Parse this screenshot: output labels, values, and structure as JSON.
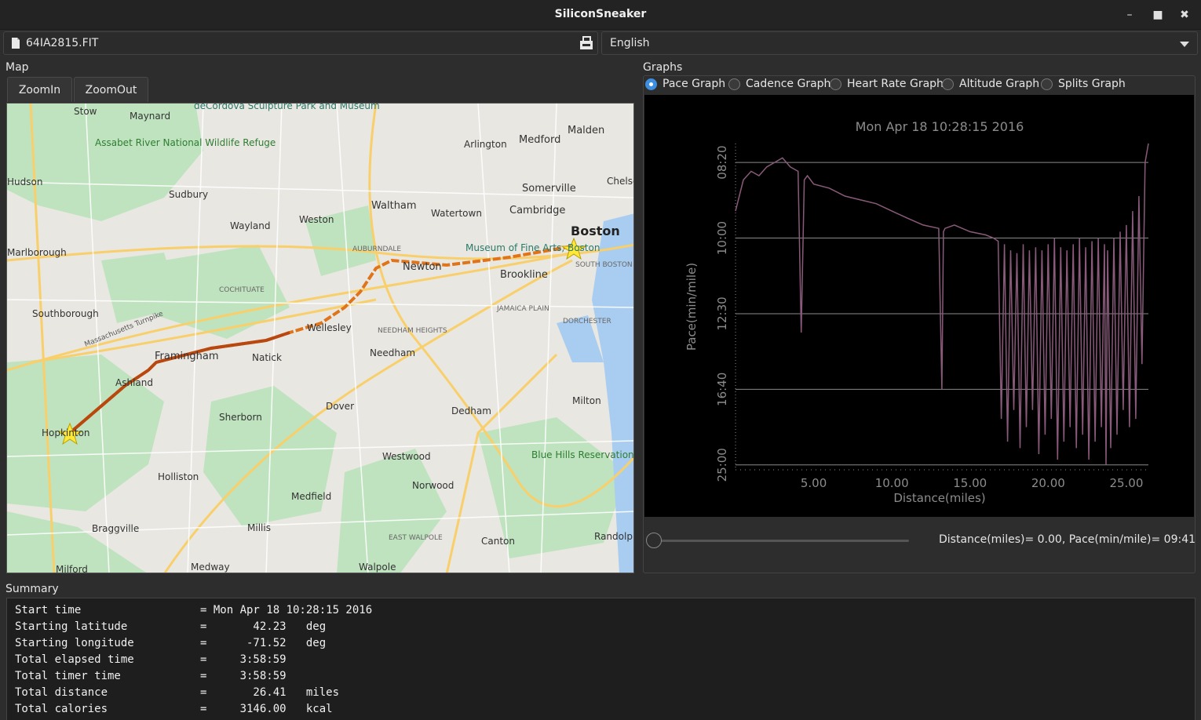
{
  "window": {
    "title": "SiliconSneaker"
  },
  "file": {
    "name": "64IA2815.FIT"
  },
  "language": {
    "selected": "English"
  },
  "map": {
    "label": "Map",
    "zoom_in_label": "ZoomIn",
    "zoom_out_label": "ZoomOut",
    "places": [
      "deCordova Sculpture Park and Museum",
      "Stow",
      "Maynard",
      "Assabet River National Wildlife Refuge",
      "Sudbury",
      "Wayland",
      "Weston",
      "Waltham",
      "Watertown",
      "Cambridge",
      "Somerville",
      "Medford",
      "Malden",
      "Arlington",
      "Boston",
      "Museum of Fine Arts, Boston",
      "Newton",
      "Brookline",
      "Marlborough",
      "Southborough",
      "Framingham",
      "Natick",
      "Wellesley",
      "Ashland",
      "Hopkinton",
      "Sherborn",
      "Dover",
      "Needham",
      "Dedham",
      "Milton",
      "Westwood",
      "Norwood",
      "Blue Hills Reservation",
      "Holliston",
      "Medfield",
      "Millis",
      "Braggville",
      "Medway",
      "Milford",
      "Walpole",
      "Canton",
      "Randolph",
      "Chelsea",
      "Hudson",
      "AUBURNDALE",
      "COCHITUATE",
      "NEEDHAM HEIGHTS",
      "JAMAICA PLAIN",
      "DORCHESTER",
      "SOUTH BOSTON",
      "EAST WALPOLE",
      "Massachusetts Turnpike"
    ],
    "route_color": "#e0741a",
    "start_marker_color": "#ffe83a"
  },
  "graphs": {
    "label": "Graphs",
    "options": [
      "Pace Graph",
      "Cadence Graph",
      "Heart Rate Graph",
      "Altitude Graph",
      "Splits Graph"
    ],
    "selected": "Pace Graph",
    "readout": "Distance(miles)= 0.00, Pace(min/mile)= 09:41"
  },
  "chart_data": {
    "type": "line",
    "title": "Mon Apr 18 10:28:15 2016",
    "xlabel": "Distance(miles)",
    "ylabel": "Pace(min/mile)",
    "xlim": [
      0,
      26.41
    ],
    "x_ticks": [
      "5.00",
      "10.00",
      "15.00",
      "20.00",
      "25.00"
    ],
    "x_tick_values": [
      5,
      10,
      15,
      20,
      25
    ],
    "y_ticks": [
      "08:20",
      "10:00",
      "12:30",
      "16:40",
      "25:00"
    ],
    "y_tick_values": [
      500,
      600,
      750,
      1000,
      1500
    ],
    "y_scale": "reciprocal",
    "line_color": "#8a5a7a",
    "series": [
      {
        "x": [
          0.0,
          0.5,
          1.0,
          1.5,
          2.0,
          2.5,
          3.0,
          3.5,
          4.0,
          4.2,
          4.4,
          4.6,
          5.0,
          6.0,
          7.0,
          8.0,
          9.0,
          10.0,
          11.0,
          12.0,
          13.0,
          13.2,
          13.3,
          13.4,
          14.0,
          15.0,
          16.0,
          16.5,
          16.8,
          17.0,
          17.2,
          17.4,
          17.6,
          17.8,
          18.0,
          18.2,
          18.4,
          18.6,
          18.8,
          19.0,
          19.2,
          19.4,
          19.6,
          19.8,
          20.0,
          20.2,
          20.4,
          20.6,
          20.8,
          21.0,
          21.2,
          21.4,
          21.6,
          21.8,
          22.0,
          22.2,
          22.4,
          22.6,
          22.8,
          23.0,
          23.2,
          23.4,
          23.6,
          23.7,
          23.8,
          24.0,
          24.2,
          24.4,
          24.6,
          24.8,
          25.0,
          25.2,
          25.4,
          25.6,
          25.8,
          26.0,
          26.2,
          26.41
        ],
        "y": [
          560,
          520,
          510,
          515,
          505,
          500,
          495,
          505,
          510,
          800,
          520,
          515,
          525,
          530,
          540,
          545,
          550,
          560,
          570,
          580,
          585,
          1000,
          590,
          585,
          580,
          590,
          595,
          600,
          605,
          1150,
          610,
          1300,
          620,
          1100,
          625,
          1350,
          610,
          1200,
          620,
          1100,
          615,
          1400,
          620,
          1250,
          610,
          1150,
          600,
          1450,
          615,
          1300,
          620,
          1200,
          610,
          1350,
          600,
          1250,
          615,
          1450,
          605,
          1300,
          600,
          1200,
          610,
          1500,
          620,
          1350,
          600,
          1250,
          590,
          1100,
          580,
          1200,
          560,
          1150,
          540,
          900,
          500,
          480
        ]
      }
    ]
  },
  "summary": {
    "label": "Summary",
    "rows": [
      {
        "key": "Start time",
        "value": "Mon Apr 18 10:28:15 2016",
        "unit": ""
      },
      {
        "key": "Starting latitude",
        "value": "42.23",
        "unit": "deg"
      },
      {
        "key": "Starting longitude",
        "value": "-71.52",
        "unit": "deg"
      },
      {
        "key": "Total elapsed time",
        "value": "3:58:59",
        "unit": ""
      },
      {
        "key": "Total timer time",
        "value": "3:58:59",
        "unit": ""
      },
      {
        "key": "Total distance",
        "value": "26.41",
        "unit": "miles"
      },
      {
        "key": "Total calories",
        "value": "3146.00",
        "unit": "kcal"
      }
    ]
  }
}
